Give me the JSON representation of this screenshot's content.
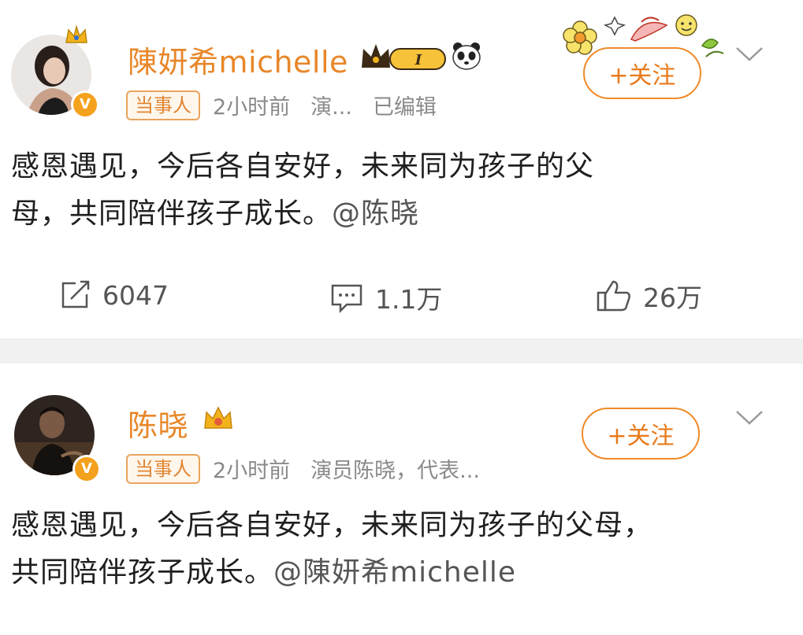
{
  "post1": {
    "author": "陳妍希michelle",
    "badge_level": "I",
    "tag": "当事人",
    "time": "2小时前",
    "source": "演...",
    "edited": "已编辑",
    "follow_label": "+关注",
    "text_line1": "感恩遇见，今后各自安好，未来同为孩子的父",
    "text_line2": "母，共同陪伴孩子成长。",
    "mention": "@陈晓",
    "repost_count": "6047",
    "comment_count": "1.1万",
    "like_count": "26万"
  },
  "post2": {
    "author": "陈晓",
    "tag": "当事人",
    "time": "2小时前",
    "source": "演员陈晓，代表...",
    "follow_label": "+关注",
    "text_line1": "感恩遇见，今后各自安好，未来同为孩子的父母，",
    "text_line2": "共同陪伴孩子成长。",
    "mention": "@陳妍希michelle"
  },
  "colors": {
    "accent": "#e8872a",
    "follow_border": "#f08a2a",
    "verified": "#f4a11d",
    "divider": "#f1f1f1"
  },
  "icons": [
    "repost-icon",
    "comment-icon",
    "like-icon",
    "verified-icon",
    "crown-icon",
    "panda-icon",
    "chevron-down-icon"
  ]
}
